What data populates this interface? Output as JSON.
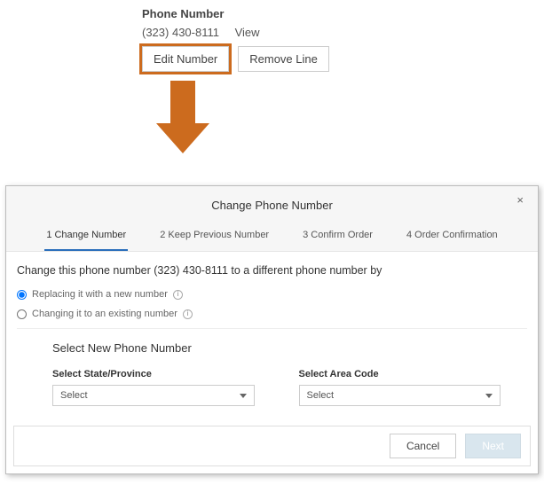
{
  "top": {
    "label": "Phone Number",
    "number": "(323) 430-8111",
    "view": "View",
    "editBtn": "Edit Number",
    "removeBtn": "Remove Line"
  },
  "modal": {
    "title": "Change Phone Number",
    "closeGlyph": "×",
    "steps": [
      {
        "n": "1",
        "t": "Change Number",
        "active": true
      },
      {
        "n": "2",
        "t": "Keep Previous Number",
        "active": false
      },
      {
        "n": "3",
        "t": "Confirm Order",
        "active": false
      },
      {
        "n": "4",
        "t": "Order Confirmation",
        "active": false
      }
    ],
    "changeText": "Change this phone number (323) 430-8111 to a different phone number by",
    "radios": [
      {
        "label": "Replacing it with a new number",
        "checked": true
      },
      {
        "label": "Changing it to an existing number",
        "checked": false
      }
    ],
    "selectTitle": "Select New Phone Number",
    "selects": [
      {
        "label": "Select State/Province",
        "value": "Select"
      },
      {
        "label": "Select Area Code",
        "value": "Select"
      }
    ],
    "footer": {
      "cancel": "Cancel",
      "next": "Next"
    }
  }
}
